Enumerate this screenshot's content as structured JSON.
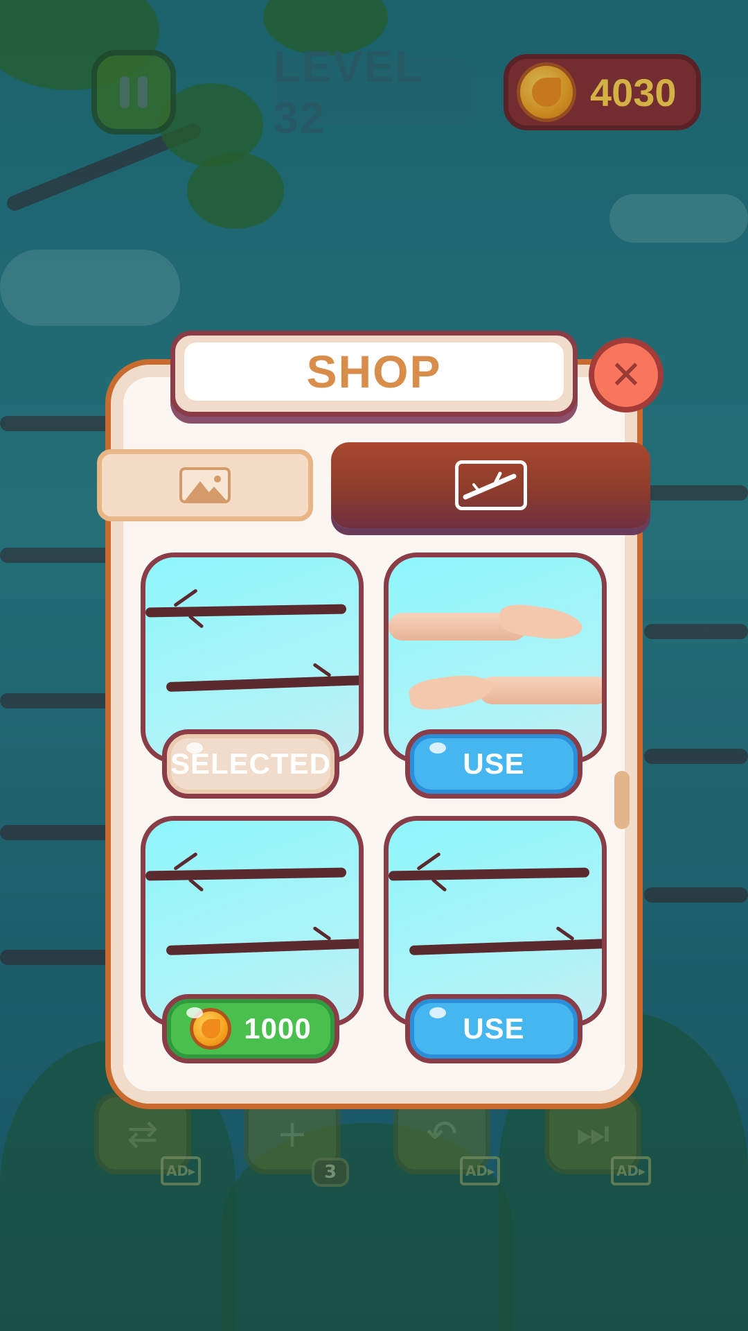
{
  "hud": {
    "level_label": "LEVEL 32",
    "coins": "4030"
  },
  "shop": {
    "title": "SHOP",
    "close_symbol": "✕",
    "tabs": [
      {
        "icon": "image-icon",
        "selected": false
      },
      {
        "icon": "branch-icon",
        "selected": true
      }
    ],
    "items": [
      {
        "skin": "branch",
        "button": "SELECTED",
        "state": "selected"
      },
      {
        "skin": "arms",
        "button": "USE",
        "state": "use"
      },
      {
        "skin": "branch",
        "button": "1000",
        "state": "buy",
        "price_icon": "coin-icon"
      },
      {
        "skin": "branch",
        "button": "USE",
        "state": "use"
      }
    ]
  },
  "powerups": [
    {
      "icon": "shuffle-icon",
      "badge": "AD▸"
    },
    {
      "icon": "add-branch-icon",
      "badge": "3"
    },
    {
      "icon": "undo-icon",
      "badge": "AD▸"
    },
    {
      "icon": "skip-icon",
      "badge": "AD▸"
    }
  ],
  "colors": {
    "panel_border": "#c96b2e",
    "title_text": "#d98d4a",
    "use_button": "#45b6ef",
    "buy_button": "#49c04e",
    "coin_text": "#ffd04a"
  }
}
